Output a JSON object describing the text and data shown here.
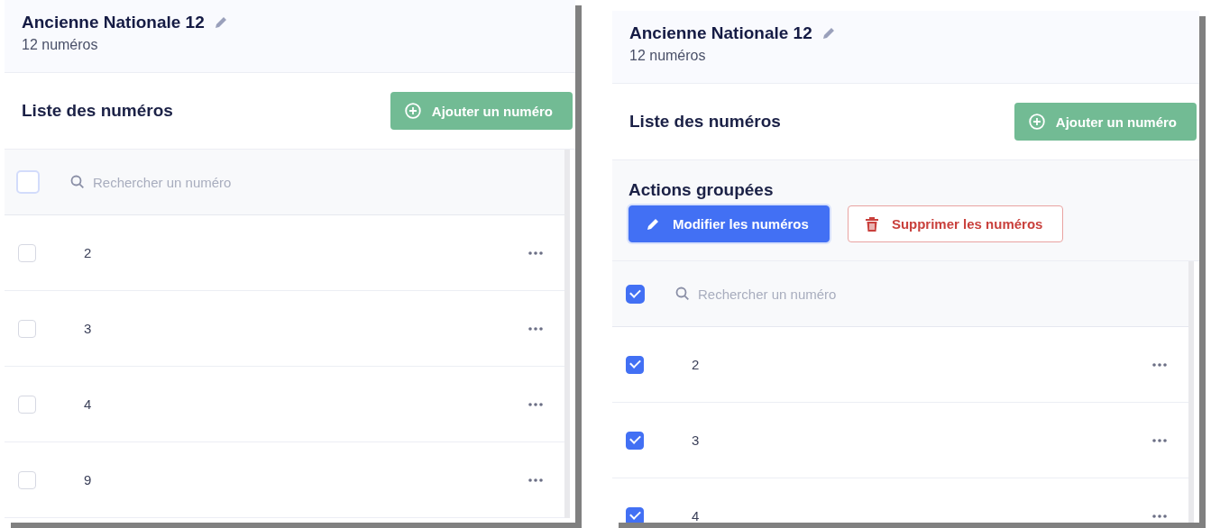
{
  "panels": [
    {
      "title": "Ancienne Nationale 12",
      "subtitle": "12 numéros",
      "list_title": "Liste des numéros",
      "add_button": "Ajouter un numéro",
      "search": {
        "placeholder": "Rechercher un numéro"
      },
      "select_all": {
        "checked": false
      },
      "rows": [
        {
          "number": "2",
          "checked": false
        },
        {
          "number": "3",
          "checked": false
        },
        {
          "number": "4",
          "checked": false
        },
        {
          "number": "9",
          "checked": false
        }
      ]
    },
    {
      "title": "Ancienne Nationale 12",
      "subtitle": "12 numéros",
      "list_title": "Liste des numéros",
      "add_button": "Ajouter un numéro",
      "bulk_actions": {
        "title": "Actions groupées",
        "buttons": [
          {
            "kind": "edit",
            "label": "Modifier les numéros"
          },
          {
            "kind": "delete",
            "label": "Supprimer les numéros"
          }
        ]
      },
      "search": {
        "placeholder": "Rechercher un numéro"
      },
      "select_all": {
        "checked": true
      },
      "rows": [
        {
          "number": "2",
          "checked": true
        },
        {
          "number": "3",
          "checked": true
        },
        {
          "number": "4",
          "checked": true
        }
      ]
    }
  ]
}
